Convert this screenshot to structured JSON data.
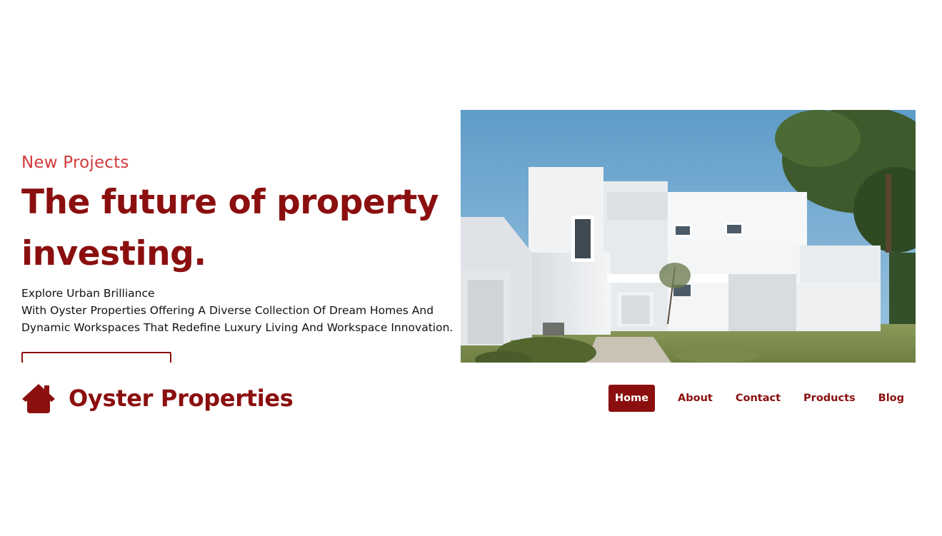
{
  "hero": {
    "eyebrow": "New Projects",
    "headline": "The future of property investing.",
    "description_lines": [
      "Explore Urban Brilliance",
      "With Oyster Properties Offering A Diverse Collection Of Dream Homes And",
      "Dynamic Workspaces That Redefine Luxury Living And Workspace Innovation."
    ],
    "cta_label": ""
  },
  "brand": {
    "name": "Oyster Properties",
    "icon": "house-icon"
  },
  "nav": {
    "items": [
      {
        "label": "Home",
        "active": true
      },
      {
        "label": "About",
        "active": false
      },
      {
        "label": "Contact",
        "active": false
      },
      {
        "label": "Products",
        "active": false
      },
      {
        "label": "Blog",
        "active": false
      }
    ]
  },
  "colors": {
    "brand": "#8b0f0f",
    "accent": "#d13a3a",
    "text": "#111111",
    "background": "#ffffff"
  }
}
